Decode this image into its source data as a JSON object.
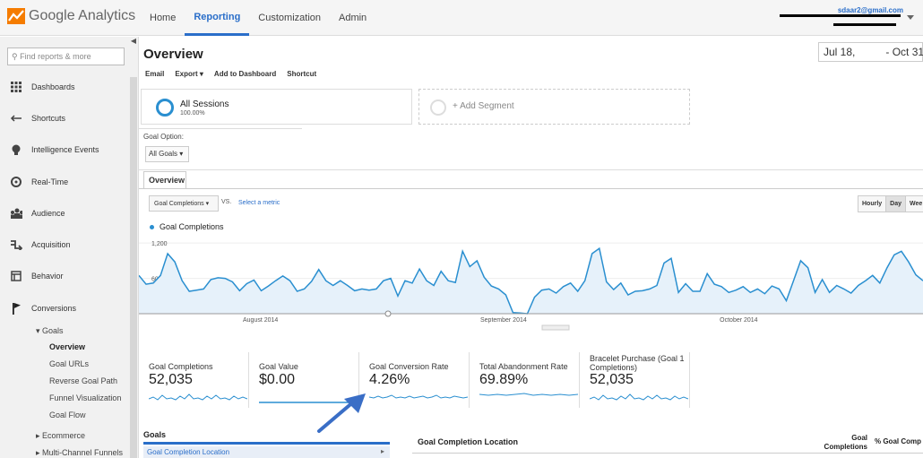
{
  "app": {
    "logo_text": "Google Analytics",
    "top_nav": [
      {
        "label": "Home",
        "active": false
      },
      {
        "label": "Reporting",
        "active": true
      },
      {
        "label": "Customization",
        "active": false
      },
      {
        "label": "Admin",
        "active": false
      }
    ],
    "account_email": "sdaar2@gmail.com",
    "accent_color": "#2a6ec9"
  },
  "sidebar": {
    "search_placeholder": "Find reports & more",
    "items": [
      {
        "label": "Dashboards",
        "icon": "grid-icon"
      },
      {
        "label": "Shortcuts",
        "icon": "shortcut-arrow-icon"
      },
      {
        "label": "Intelligence Events",
        "icon": "lightbulb-icon"
      },
      {
        "label": "Real-Time",
        "icon": "clock-icon"
      },
      {
        "label": "Audience",
        "icon": "people-icon"
      },
      {
        "label": "Acquisition",
        "icon": "acquisition-arrows-icon"
      },
      {
        "label": "Behavior",
        "icon": "behavior-window-icon"
      },
      {
        "label": "Conversions",
        "icon": "flag-icon"
      }
    ],
    "goals_parent": "▾ Goals",
    "goals_sub": [
      "Overview",
      "Goal URLs",
      "Reverse Goal Path",
      "Funnel Visualization",
      "Goal Flow"
    ],
    "ecommerce": "▸ Ecommerce",
    "multichannel": "▸ Multi-Channel Funnels"
  },
  "main": {
    "title": "Overview",
    "date_start": "Jul 18,",
    "date_end": "- Oct 31",
    "toolbar": {
      "email": "Email",
      "export": "Export ▾",
      "dashboard": "Add to Dashboard",
      "shortcut": "Shortcut"
    },
    "segment": {
      "label": "All Sessions",
      "sub": "100.00%"
    },
    "add_segment": "+ Add Segment",
    "goal_option_label": "Goal Option:",
    "goal_option_value": "All Goals ▾",
    "tab": "Overview",
    "metric_select": "Goal Completions ▾",
    "vs": "VS.",
    "select_metric": "Select a metric",
    "granularity": [
      "Hourly",
      "Day",
      "Wee"
    ]
  },
  "chart_data": {
    "type": "area",
    "series": [
      {
        "name": "Goal Completions",
        "color": "#2a8fd0"
      }
    ],
    "y_ticks": [
      "1,200",
      "600"
    ],
    "x_tick_labels": [
      "August 2014",
      "September 2014",
      "October 2014"
    ],
    "ylim": [
      0,
      1400
    ],
    "values": [
      650,
      500,
      520,
      650,
      1020,
      880,
      560,
      380,
      400,
      420,
      580,
      610,
      600,
      540,
      390,
      510,
      570,
      390,
      470,
      560,
      640,
      560,
      380,
      420,
      550,
      750,
      560,
      480,
      560,
      480,
      390,
      420,
      400,
      420,
      560,
      600,
      300,
      560,
      520,
      760,
      560,
      480,
      720,
      560,
      530,
      1060,
      800,
      900,
      620,
      470,
      420,
      320,
      20,
      10,
      0,
      280,
      400,
      420,
      350,
      460,
      520,
      380,
      560,
      1020,
      1110,
      540,
      410,
      520,
      320,
      380,
      390,
      420,
      480,
      860,
      940,
      360,
      510,
      380,
      380,
      680,
      500,
      460,
      360,
      400,
      460,
      360,
      420,
      340,
      470,
      420,
      220,
      560,
      900,
      780,
      360,
      580,
      360,
      480,
      420,
      350,
      480,
      560,
      650,
      520,
      780,
      1000,
      1060,
      880,
      660,
      560
    ]
  },
  "scorecards": [
    {
      "title": "Goal Completions",
      "value": "52,035"
    },
    {
      "title": "Goal Value",
      "value": "$0.00"
    },
    {
      "title": "Goal Conversion Rate",
      "value": "4.26%"
    },
    {
      "title": "Total Abandonment Rate",
      "value": "69.89%"
    },
    {
      "title": "Bracelet Purchase (Goal 1 Completions)",
      "value": "52,035"
    }
  ],
  "table": {
    "goals_header": "Goals",
    "goals_row": "Goal Completion Location",
    "col_location": "Goal Completion Location",
    "col_completions": "Goal Completions",
    "col_pct": "% Goal Comp"
  }
}
